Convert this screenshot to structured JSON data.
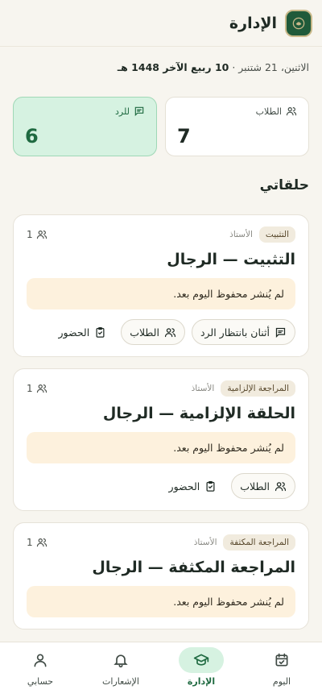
{
  "header": {
    "title": "الإدارة"
  },
  "date_line": {
    "weekday_date": "الاثنين، 21 شتنبر · ",
    "hijri": "10 ربيع الآخر 1448 هـ"
  },
  "stats": {
    "students": {
      "label": "الطلاب",
      "value": "7"
    },
    "review": {
      "label": "للرد",
      "value": "6"
    }
  },
  "section_title": "حلقاتي",
  "cards": [
    {
      "tag": "التثبيت",
      "teacher": "الأستاذ",
      "count": "1",
      "title": "التثبيت — الرجال",
      "notice": "لم يُنشر محفوظ اليوم بعد.",
      "action_awaiting": "أثنان بانتظار الرد",
      "action_students": "الطلاب",
      "action_attendance": "الحضور"
    },
    {
      "tag": "المراجعة الإلزامية",
      "teacher": "الأستاذ",
      "count": "1",
      "title": "الحلقة الإلزامية — الرجال",
      "notice": "لم يُنشر محفوظ اليوم بعد.",
      "action_students": "الطلاب",
      "action_attendance": "الحضور"
    },
    {
      "tag": "المراجعة المكثفة",
      "teacher": "الأستاذ",
      "count": "1",
      "title": "المراجعة المكثفة — الرجال",
      "notice": "لم يُنشر محفوظ اليوم بعد."
    }
  ],
  "nav": {
    "today": "اليوم",
    "admin": "الإدارة",
    "notifications": "الإشعارات",
    "account": "حسابي"
  },
  "colors": {
    "accent": "#1f6a41",
    "accent_bg": "#d6f2e1",
    "notice_bg": "#fdf1dd"
  },
  "icons": [
    "users-icon",
    "message-icon",
    "clipboard-icon",
    "calendar-check-icon",
    "graduation-cap-icon",
    "bell-icon",
    "user-icon"
  ]
}
